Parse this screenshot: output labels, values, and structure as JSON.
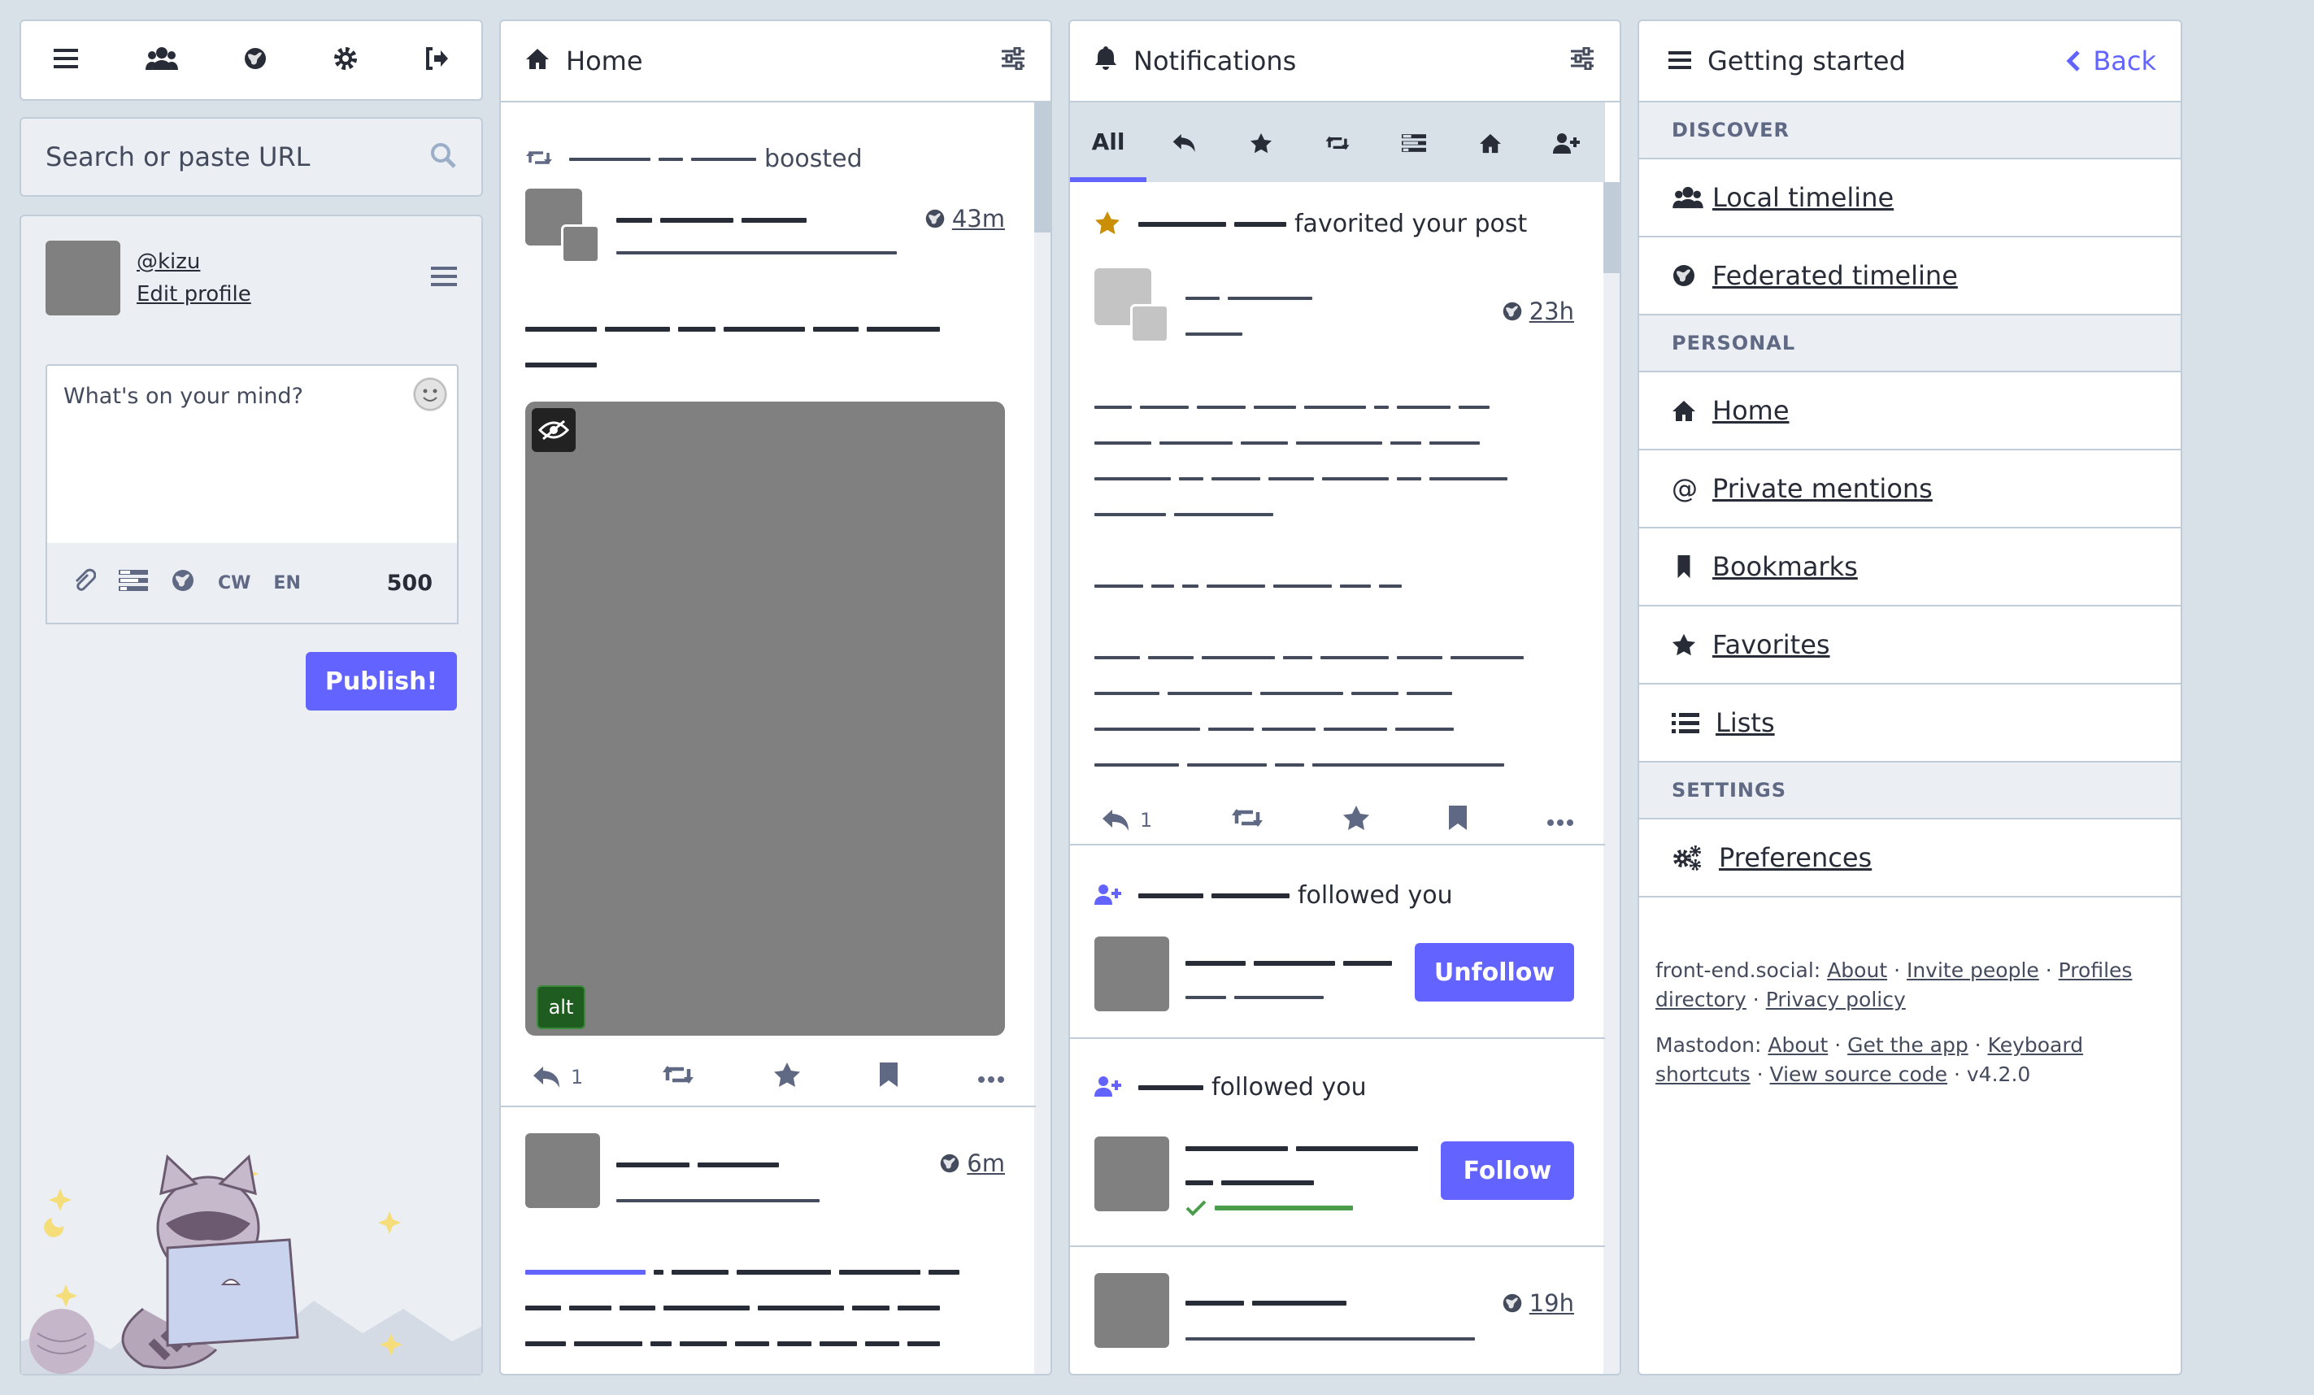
{
  "nav": {
    "search_placeholder": "Search or paste URL",
    "profile": {
      "handle": "@kizu",
      "edit_label": "Edit profile"
    },
    "compose": {
      "placeholder": "What's on your mind?",
      "cw_label": "CW",
      "lang_label": "EN",
      "counter": "500",
      "publish_label": "Publish!"
    }
  },
  "home": {
    "title": "Home",
    "boost_label": "boosted",
    "status1": {
      "time": "43m",
      "alt_label": "alt",
      "reply_count": "1"
    },
    "status2": {
      "time": "6m"
    }
  },
  "notifications": {
    "title": "Notifications",
    "tabs": {
      "all": "All"
    },
    "fav": {
      "text": "favorited your post",
      "time": "23h",
      "reply_count": "1"
    },
    "follow1": {
      "text": "followed you",
      "button": "Unfollow"
    },
    "follow2": {
      "text": "followed you",
      "button": "Follow"
    },
    "status3": {
      "time": "19h"
    }
  },
  "getting_started": {
    "title": "Getting started",
    "back_label": "Back",
    "sections": {
      "discover": "DISCOVER",
      "personal": "PERSONAL",
      "settings": "SETTINGS"
    },
    "items": {
      "local": "Local timeline",
      "federated": "Federated timeline",
      "home": "Home",
      "mentions": "Private mentions",
      "bookmarks": "Bookmarks",
      "favorites": "Favorites",
      "lists": "Lists",
      "preferences": "Preferences"
    },
    "footer": {
      "site_label": "front-end.social:",
      "about": "About",
      "invite": "Invite people",
      "profiles": "Profiles directory",
      "privacy": "Privacy policy",
      "mastodon_label": "Mastodon:",
      "m_about": "About",
      "get_app": "Get the app",
      "shortcuts": "Keyboard shortcuts",
      "source": "View source code",
      "version": "v4.2.0"
    }
  },
  "colors": {
    "accent": "#6364ff",
    "bg": "#d9e1e8",
    "border": "#c0cdd9",
    "star": "#ca8f04"
  }
}
